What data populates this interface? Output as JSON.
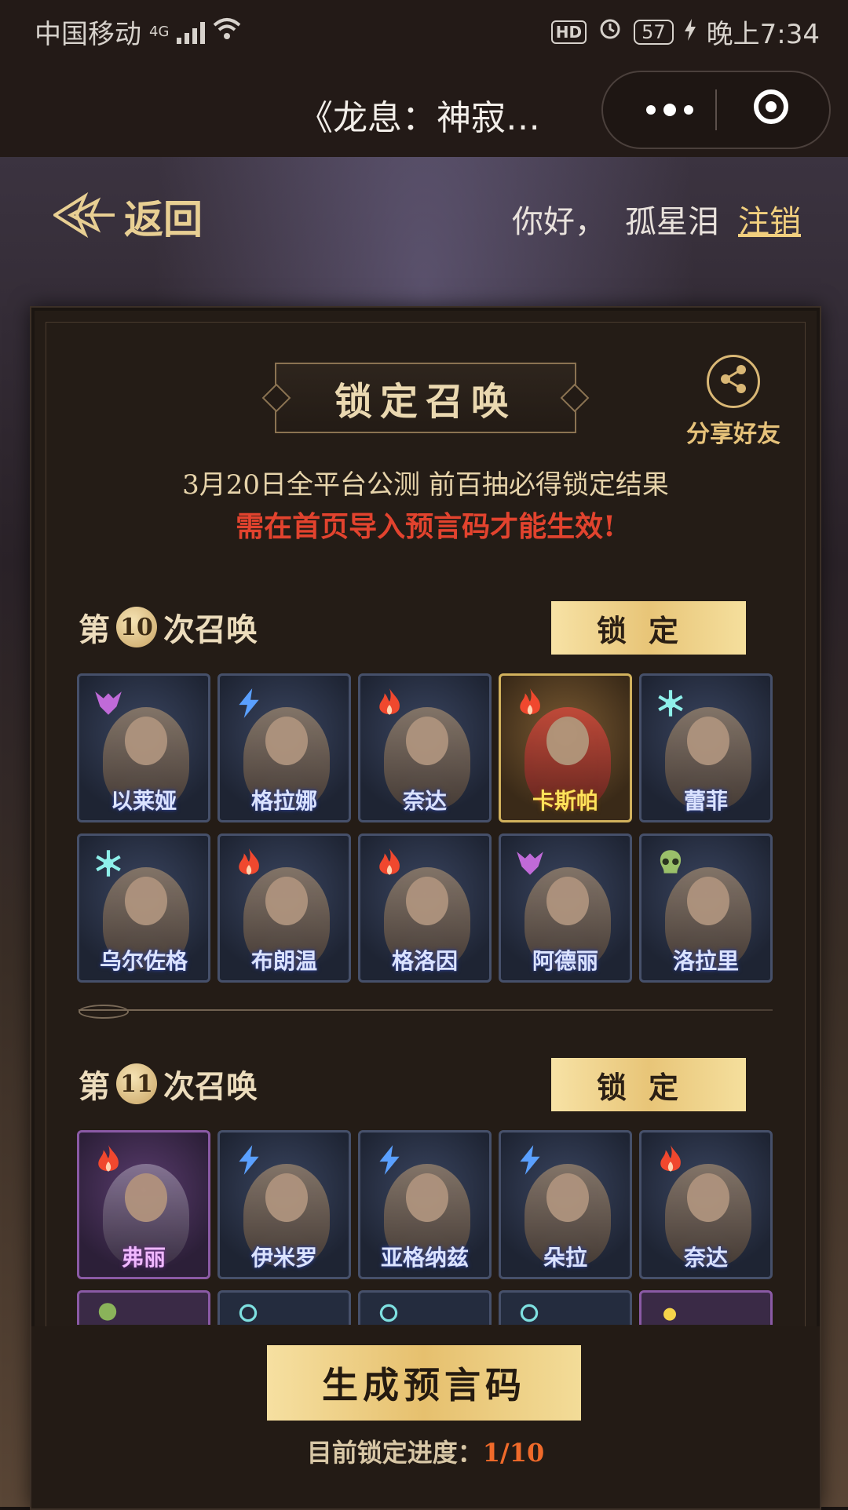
{
  "status_bar": {
    "carrier": "中国移动",
    "network": "4G",
    "battery": "57",
    "time": "晚上7:34",
    "icons": [
      "signal-icon",
      "wifi-icon",
      "hd-icon",
      "alarm-icon",
      "battery-icon",
      "charging-icon"
    ]
  },
  "titlebar": {
    "title": "《龙息：神寂…",
    "more_icon": "more-dots-icon",
    "close_icon": "miniprogram-close-icon"
  },
  "header": {
    "back_label": "返回",
    "greeting": "你好，",
    "username": "孤星泪",
    "logout_label": "注销"
  },
  "panel": {
    "title": "锁定召唤",
    "share_label": "分享好友",
    "notice_line1": "3月20日全平台公测 前百抽必得锁定结果",
    "notice_line2": "需在首页导入预言码才能生效!"
  },
  "rounds": [
    {
      "prefix": "第",
      "number": "10",
      "suffix": "次召唤",
      "lock_label": "锁定",
      "heroes": [
        {
          "name": "以莱娅",
          "element": "dragon"
        },
        {
          "name": "格拉娜",
          "element": "lightning"
        },
        {
          "name": "奈达",
          "element": "fire"
        },
        {
          "name": "卡斯帕",
          "element": "fire",
          "selected": true
        },
        {
          "name": "蕾菲",
          "element": "frost"
        },
        {
          "name": "乌尔佐格",
          "element": "frost"
        },
        {
          "name": "布朗温",
          "element": "fire"
        },
        {
          "name": "格洛因",
          "element": "fire"
        },
        {
          "name": "阿德丽",
          "element": "dragon"
        },
        {
          "name": "洛拉里",
          "element": "poison"
        }
      ]
    },
    {
      "prefix": "第",
      "number": "11",
      "suffix": "次召唤",
      "lock_label": "锁定",
      "heroes": [
        {
          "name": "弗丽",
          "element": "fire",
          "rarity": "epic"
        },
        {
          "name": "伊米罗",
          "element": "lightning"
        },
        {
          "name": "亚格纳兹",
          "element": "lightning"
        },
        {
          "name": "朵拉",
          "element": "lightning"
        },
        {
          "name": "奈达",
          "element": "fire"
        }
      ]
    }
  ],
  "footer": {
    "generate_label": "生成预言码",
    "progress_label": "目前锁定进度：",
    "progress_value": "1/10"
  },
  "colors": {
    "gold": "#e8c578",
    "alert_red": "#e2432e",
    "progress_orange": "#ef6a2a",
    "card_border": "#46506a"
  }
}
